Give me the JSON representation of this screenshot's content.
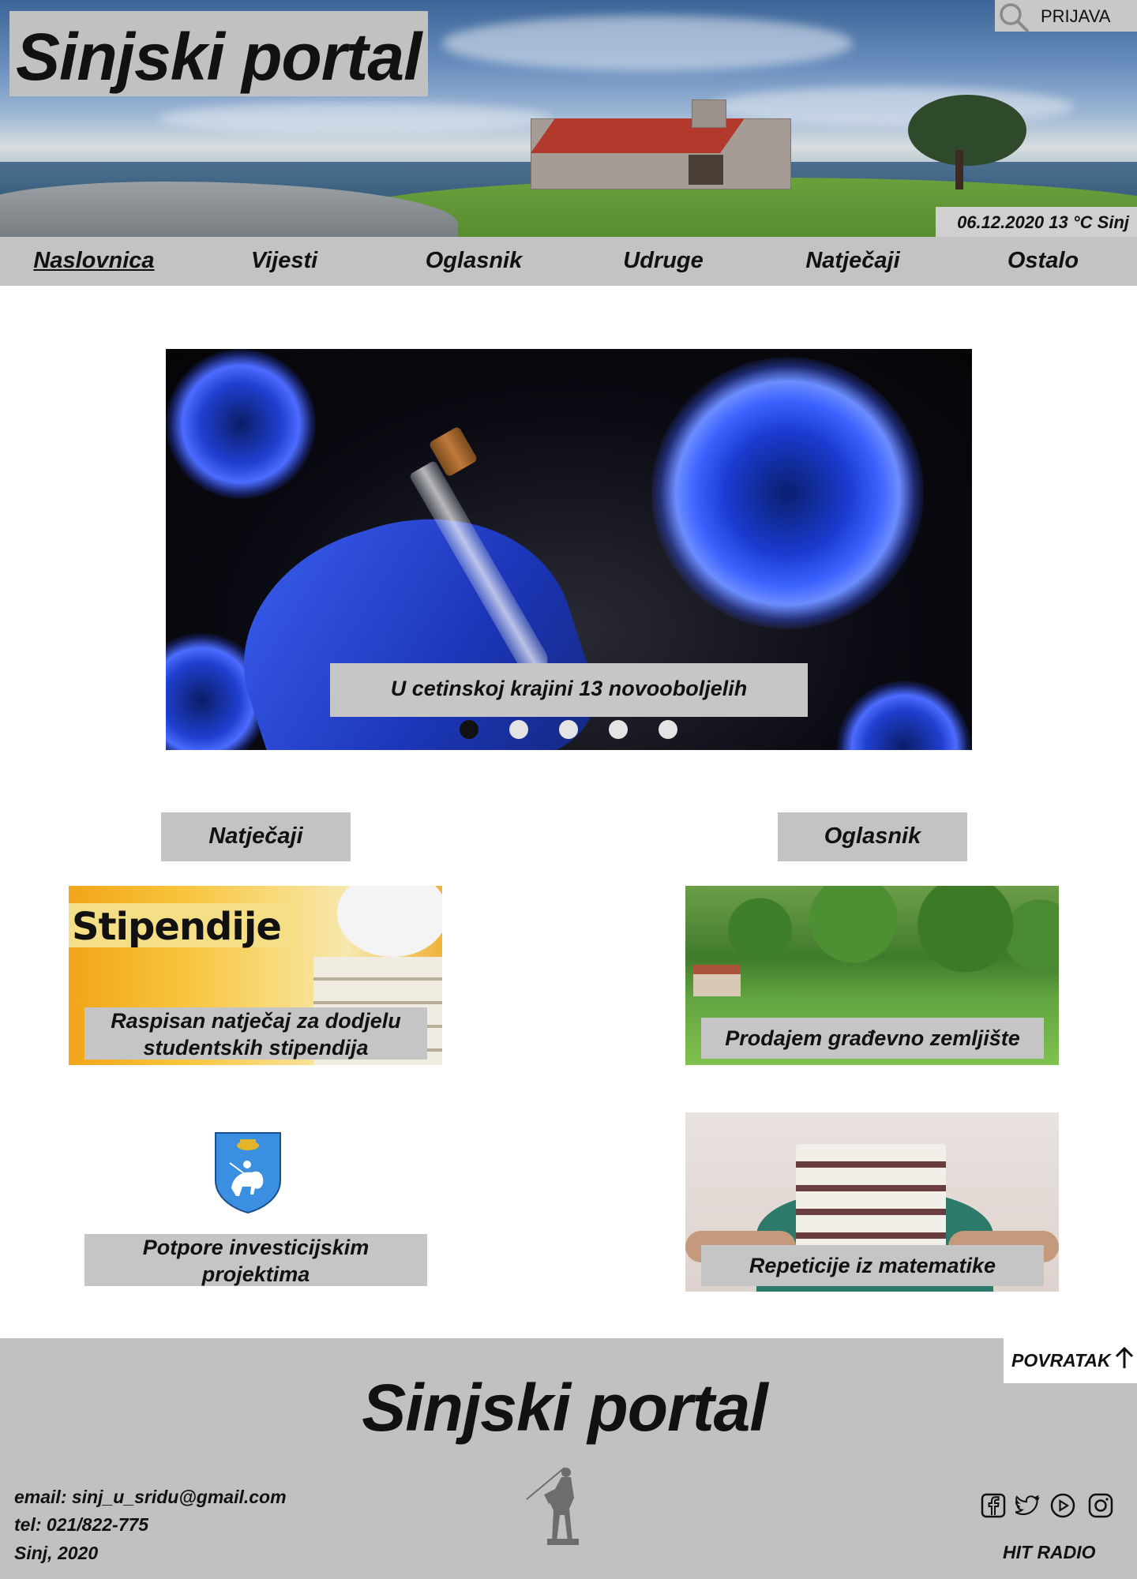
{
  "header": {
    "site_title": "Sinjski portal",
    "login_label": "PRIJAVA",
    "date_weather": "06.12.2020  13 °C Sinj"
  },
  "nav": {
    "items": [
      {
        "label": "Naslovnica",
        "active": true
      },
      {
        "label": "Vijesti"
      },
      {
        "label": "Oglasnik"
      },
      {
        "label": "Udruge"
      },
      {
        "label": "Natječaji"
      },
      {
        "label": "Ostalo"
      }
    ]
  },
  "slider": {
    "caption": "U cetinskoj krajini 13 novooboljelih",
    "slide_count": 5,
    "active_index": 0
  },
  "sections": {
    "left_label": "Natječaji",
    "right_label": "Oglasnik"
  },
  "cards": {
    "stipendije": {
      "image_text": "Stipendije",
      "caption_line1": "Raspisan natječaj za dodjelu",
      "caption_line2": "studentskih stipendija"
    },
    "zemljiste": {
      "caption": "Prodajem građevno zemljište"
    },
    "potpore": {
      "caption_line1": "Potpore investicijskim",
      "caption_line2": "projektima"
    },
    "matematika": {
      "caption": "Repeticije iz matematike"
    }
  },
  "footer": {
    "back_label": "POVRATAK",
    "title": "Sinjski portal",
    "email": "email: sinj_u_sridu@gmail.com",
    "tel": "tel: 021/822-775",
    "place_year": "Sinj, 2020",
    "social_icons": [
      "facebook-icon",
      "twitter-icon",
      "youtube-icon",
      "instagram-icon"
    ],
    "radio_label": "HIT RADIO"
  }
}
